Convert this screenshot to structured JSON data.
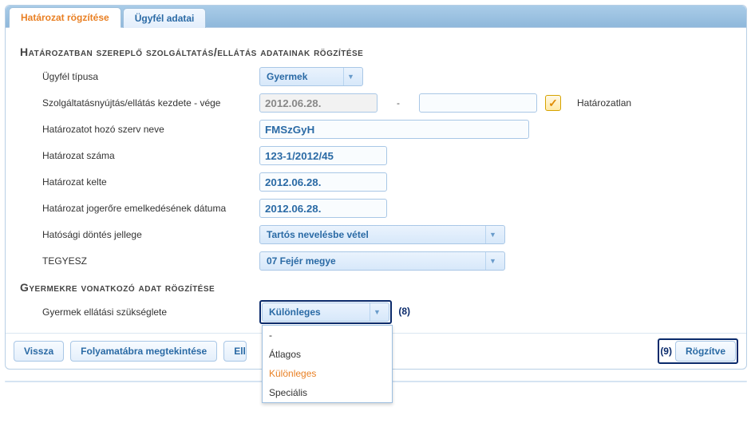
{
  "tabs": {
    "active": "Határozat rögzítése",
    "other": "Ügyfél adatai"
  },
  "section1": {
    "title": "Határozatban szereplő szolgáltatás/ellátás adatainak rögzítése",
    "rows": {
      "ugyfel_tipus_label": "Ügyfél típusa",
      "ugyfel_tipus_value": "Gyermek",
      "szolg_label": "Szolgáltatásnyújtás/ellátás kezdete - vége",
      "szolg_start": "2012.06.28.",
      "szolg_end": "",
      "hatarozatlan_label": "Határozatlan",
      "szerv_label": "Határozatot hozó szerv neve",
      "szerv_value": "FMSzGyH",
      "szam_label": "Határozat száma",
      "szam_value": "123-1/2012/45",
      "kelte_label": "Határozat kelte",
      "kelte_value": "2012.06.28.",
      "jogero_label": "Határozat jogerőre emelkedésének dátuma",
      "jogero_value": "2012.06.28.",
      "dontes_label": "Hatósági döntés jellege",
      "dontes_value": "Tartós nevelésbe vétel",
      "tegyesz_label": "TEGYESZ",
      "tegyesz_value": "07 Fejér megye"
    }
  },
  "section2": {
    "title": "Gyermekre vonatkozó adat rögzítése",
    "label": "Gyermek ellátási szükséglete",
    "selected": "Különleges",
    "options": [
      "-",
      "Átlagos",
      "Különleges",
      "Speciális"
    ],
    "ann": "(8)"
  },
  "buttons": {
    "vissza": "Vissza",
    "folyamat": "Folyamatábra megtekintése",
    "ell": "Ell",
    "rogzitve": "Rögzítve",
    "rog_ann": "(9)"
  },
  "icons": {
    "check": "✓",
    "caret": "▼",
    "dash": "-"
  }
}
